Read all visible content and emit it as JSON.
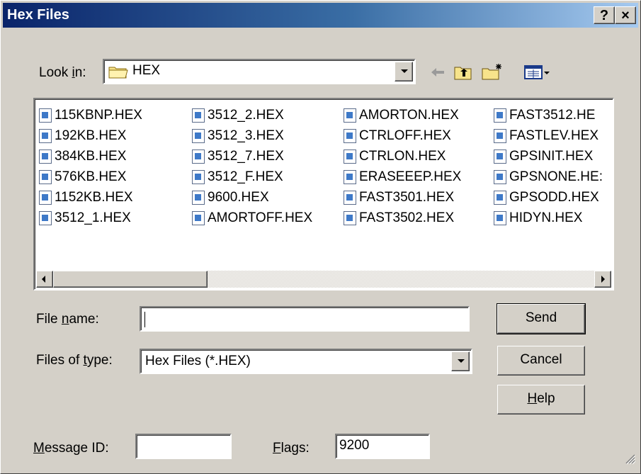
{
  "window": {
    "title": "Hex Files",
    "help_glyph": "?",
    "close_glyph": "×"
  },
  "look_in": {
    "label_pre": "Look ",
    "label_accel": "i",
    "label_post": "n:",
    "value": "HEX"
  },
  "toolbar": {
    "back_icon": "back-arrow-icon",
    "up_icon": "up-folder-icon",
    "new_icon": "new-folder-icon",
    "view_icon": "view-menu-icon"
  },
  "files": {
    "columns": [
      [
        "115KBNP.HEX",
        "192KB.HEX",
        "384KB.HEX",
        "576KB.HEX",
        "1152KB.HEX",
        "3512_1.HEX"
      ],
      [
        "3512_2.HEX",
        "3512_3.HEX",
        "3512_7.HEX",
        "3512_F.HEX",
        "9600.HEX",
        "AMORTOFF.HEX"
      ],
      [
        "AMORTON.HEX",
        "CTRLOFF.HEX",
        "CTRLON.HEX",
        "ERASEEEP.HEX",
        "FAST3501.HEX",
        "FAST3502.HEX"
      ],
      [
        "FAST3512.HE",
        "FASTLEV.HEX",
        "GPSINIT.HEX",
        "GPSNONE.HE:",
        "GPSODD.HEX",
        "HIDYN.HEX"
      ]
    ]
  },
  "file_name": {
    "label_pre": "File ",
    "label_accel": "n",
    "label_post": "ame:",
    "value": ""
  },
  "file_type": {
    "label_pre": "Files of ",
    "label_accel": "t",
    "label_post": "ype:",
    "value": "Hex Files (*.HEX)"
  },
  "buttons": {
    "send": "Send",
    "cancel": "Cancel",
    "help_accel": "H",
    "help_rest": "elp"
  },
  "message_id": {
    "label_accel": "M",
    "label_rest": "essage ID:",
    "value": ""
  },
  "flags": {
    "label_accel": "F",
    "label_rest": "lags:",
    "value": "9200"
  }
}
